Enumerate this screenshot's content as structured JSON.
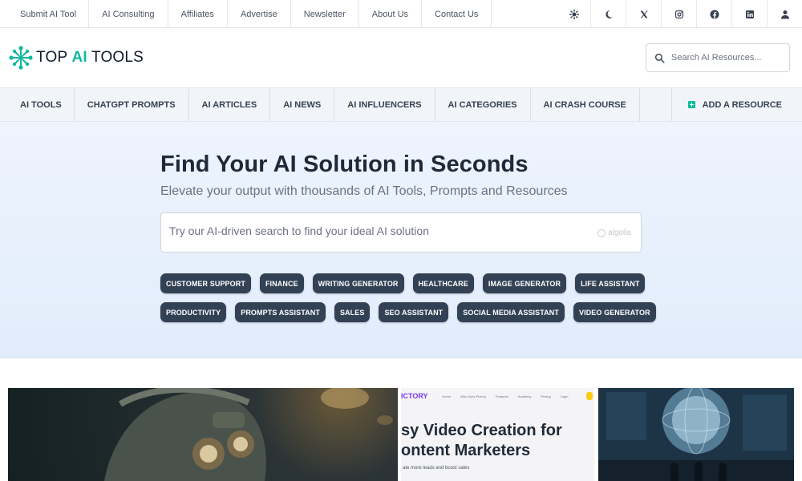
{
  "topbar": {
    "links": [
      "Submit AI Tool",
      "AI Consulting",
      "Affiliates",
      "Advertise",
      "Newsletter",
      "About Us",
      "Contact Us"
    ],
    "icons": [
      "sun-icon",
      "moon-icon",
      "x-icon",
      "instagram-icon",
      "facebook-icon",
      "linkedin-icon",
      "user-icon"
    ]
  },
  "header": {
    "logo_top": "TOP ",
    "logo_ai": "AI",
    "logo_tools": " TOOLS",
    "search_placeholder": "Search AI Resources..."
  },
  "nav": {
    "items": [
      "AI TOOLS",
      "CHATGPT PROMPTS",
      "AI ARTICLES",
      "AI NEWS",
      "AI INFLUENCERS",
      "AI CATEGORIES",
      "AI CRASH COURSE"
    ],
    "add_resource": "ADD A RESOURCE"
  },
  "hero": {
    "title": "Find Your AI Solution in Seconds",
    "subtitle": "Elevate your output with thousands of AI Tools, Prompts and Resources",
    "search_placeholder": "Try our AI-driven search to find your ideal AI solution",
    "search_badge": "algolia",
    "chips_row1": [
      "CUSTOMER SUPPORT",
      "FINANCE",
      "WRITING GENERATOR",
      "HEALTHCARE",
      "IMAGE GENERATOR",
      "LIFE ASSISTANT"
    ],
    "chips_row2": [
      "PRODUCTIVITY",
      "PROMPTS ASSISTANT",
      "SALES",
      "SEO ASSISTANT",
      "SOCIAL MEDIA ASSISTANT",
      "VIDEO GENERATOR"
    ]
  },
  "cards": {
    "card2_brand": "ICTORY",
    "card2_nav": [
      "Home",
      "Who Uses Pictory",
      "Features",
      "Academy",
      "Pricing",
      "Login"
    ],
    "card2_line1": "sy Video Creation for",
    "card2_line2": "ontent Marketers",
    "card2_small": "ate more leads and boost sales"
  },
  "colors": {
    "accent": "#10b9a0",
    "chip_bg": "#334155",
    "hero_bg": "#e6effc"
  }
}
